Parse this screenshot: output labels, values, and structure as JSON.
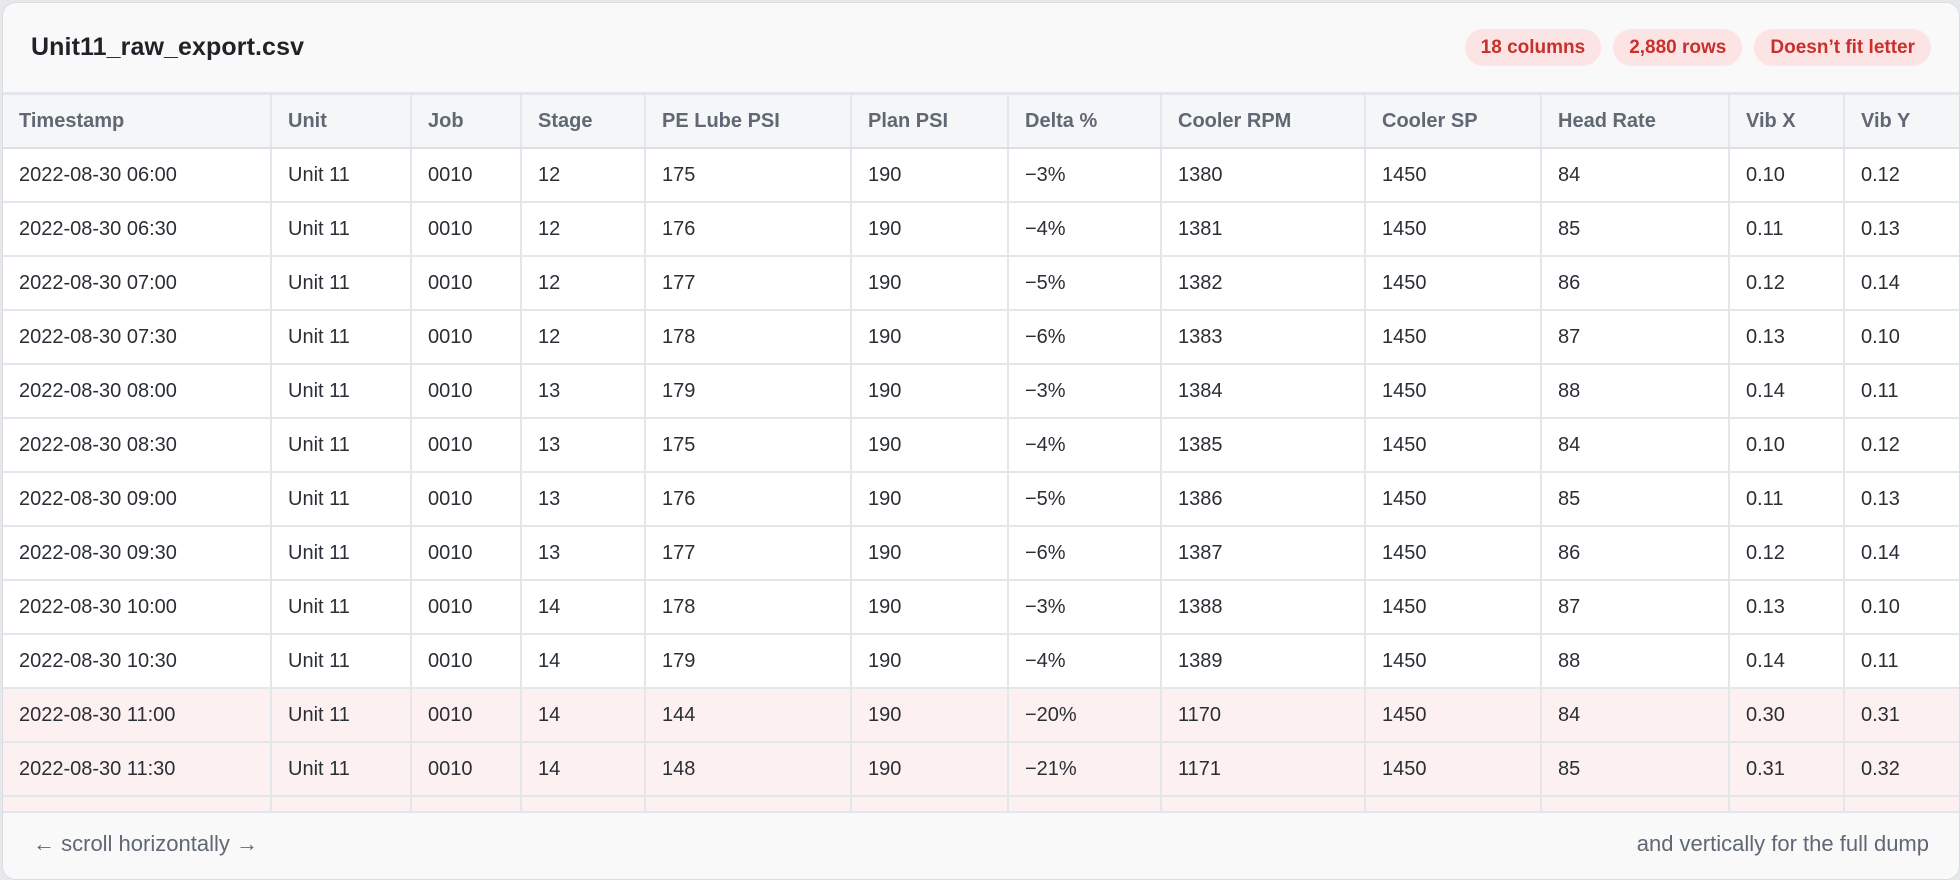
{
  "file": {
    "title": "Unit11_raw_export.csv"
  },
  "badges": [
    {
      "label": "18 columns"
    },
    {
      "label": "2,880 rows"
    },
    {
      "label": "Doesn’t fit letter"
    }
  ],
  "table": {
    "columns": [
      "Timestamp",
      "Unit",
      "Job",
      "Stage",
      "PE Lube PSI",
      "Plan PSI",
      "Delta %",
      "Cooler RPM",
      "Cooler SP",
      "Head Rate",
      "Vib X",
      "Vib Y"
    ],
    "rows": [
      {
        "cells": [
          "2022-08-30 06:00",
          "Unit 11",
          "0010",
          "12",
          "175",
          "190",
          "−3%",
          "1380",
          "1450",
          "84",
          "0.10",
          "0.12"
        ],
        "highlight": false
      },
      {
        "cells": [
          "2022-08-30 06:30",
          "Unit 11",
          "0010",
          "12",
          "176",
          "190",
          "−4%",
          "1381",
          "1450",
          "85",
          "0.11",
          "0.13"
        ],
        "highlight": false
      },
      {
        "cells": [
          "2022-08-30 07:00",
          "Unit 11",
          "0010",
          "12",
          "177",
          "190",
          "−5%",
          "1382",
          "1450",
          "86",
          "0.12",
          "0.14"
        ],
        "highlight": false
      },
      {
        "cells": [
          "2022-08-30 07:30",
          "Unit 11",
          "0010",
          "12",
          "178",
          "190",
          "−6%",
          "1383",
          "1450",
          "87",
          "0.13",
          "0.10"
        ],
        "highlight": false
      },
      {
        "cells": [
          "2022-08-30 08:00",
          "Unit 11",
          "0010",
          "13",
          "179",
          "190",
          "−3%",
          "1384",
          "1450",
          "88",
          "0.14",
          "0.11"
        ],
        "highlight": false
      },
      {
        "cells": [
          "2022-08-30 08:30",
          "Unit 11",
          "0010",
          "13",
          "175",
          "190",
          "−4%",
          "1385",
          "1450",
          "84",
          "0.10",
          "0.12"
        ],
        "highlight": false
      },
      {
        "cells": [
          "2022-08-30 09:00",
          "Unit 11",
          "0010",
          "13",
          "176",
          "190",
          "−5%",
          "1386",
          "1450",
          "85",
          "0.11",
          "0.13"
        ],
        "highlight": false
      },
      {
        "cells": [
          "2022-08-30 09:30",
          "Unit 11",
          "0010",
          "13",
          "177",
          "190",
          "−6%",
          "1387",
          "1450",
          "86",
          "0.12",
          "0.14"
        ],
        "highlight": false
      },
      {
        "cells": [
          "2022-08-30 10:00",
          "Unit 11",
          "0010",
          "14",
          "178",
          "190",
          "−3%",
          "1388",
          "1450",
          "87",
          "0.13",
          "0.10"
        ],
        "highlight": false
      },
      {
        "cells": [
          "2022-08-30 10:30",
          "Unit 11",
          "0010",
          "14",
          "179",
          "190",
          "−4%",
          "1389",
          "1450",
          "88",
          "0.14",
          "0.11"
        ],
        "highlight": false
      },
      {
        "cells": [
          "2022-08-30 11:00",
          "Unit 11",
          "0010",
          "14",
          "144",
          "190",
          "−20%",
          "1170",
          "1450",
          "84",
          "0.30",
          "0.31"
        ],
        "highlight": true
      },
      {
        "cells": [
          "2022-08-30 11:30",
          "Unit 11",
          "0010",
          "14",
          "148",
          "190",
          "−21%",
          "1171",
          "1450",
          "85",
          "0.31",
          "0.32"
        ],
        "highlight": true
      },
      {
        "cells": [
          "",
          "",
          "",
          "",
          "",
          "",
          "",
          "",
          "",
          "",
          "",
          ""
        ],
        "highlight": true
      }
    ]
  },
  "footer": {
    "left": "← scroll horizontally →",
    "right": "and vertically for the full dump"
  },
  "colors": {
    "badge_bg": "#fde4e4",
    "badge_text": "#c9302c",
    "alert_row_bg": "#fdf0f0"
  }
}
